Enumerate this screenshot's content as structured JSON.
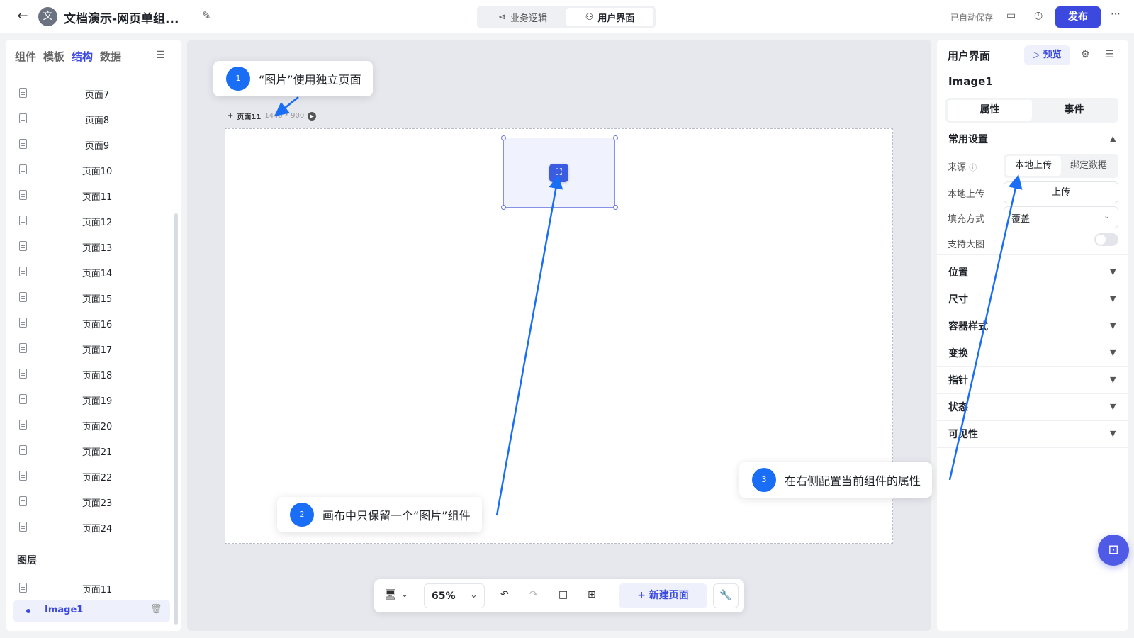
{
  "topbar": {
    "app_avatar": "文",
    "title": "文档演示-网页单组...",
    "tabs": [
      {
        "label": "业务逻辑",
        "icon": "share-icon"
      },
      {
        "label": "用户界面",
        "icon": "user-icon"
      }
    ],
    "autosave": "已自动保存",
    "publish": "发布",
    "accent": "#3b49df"
  },
  "left_panel": {
    "tabs": [
      "组件",
      "模板",
      "结构",
      "数据"
    ],
    "active_tab": "结构",
    "pages": [
      "页面7",
      "页面8",
      "页面9",
      "页面10",
      "页面11",
      "页面12",
      "页面13",
      "页面14",
      "页面15",
      "页面16",
      "页面17",
      "页面18",
      "页面19",
      "页面20",
      "页面21",
      "页面22",
      "页面23",
      "页面24"
    ],
    "layers_title": "图层",
    "layer_page": "页面11",
    "layer_component": "Image1"
  },
  "canvas": {
    "page_tag": "页面11",
    "page_size": "1440 * 900"
  },
  "toolbar": {
    "zoom": "65%",
    "new_page": "新建页面"
  },
  "right_panel": {
    "title": "用户界面",
    "preview": "预览",
    "component_name": "Image1",
    "tabs": [
      "属性",
      "事件"
    ],
    "common_settings": "常用设置",
    "source_label": "来源",
    "source_options": [
      "本地上传",
      "绑定数据"
    ],
    "local_upload_label": "本地上传",
    "upload_button": "上传",
    "fill_label": "填充方式",
    "fill_value": "覆盖",
    "large_image_label": "支持大图",
    "large_image_enabled": false,
    "sections": [
      "位置",
      "尺寸",
      "容器样式",
      "变换",
      "指针",
      "状态",
      "可见性"
    ]
  },
  "callouts": [
    {
      "num": "1",
      "text": "“图片”使用独立页面"
    },
    {
      "num": "2",
      "text": "画布中只保留一个“图片”组件"
    },
    {
      "num": "3",
      "text": "在右侧配置当前组件的属性"
    }
  ],
  "callout_color": "#1a6ef5"
}
